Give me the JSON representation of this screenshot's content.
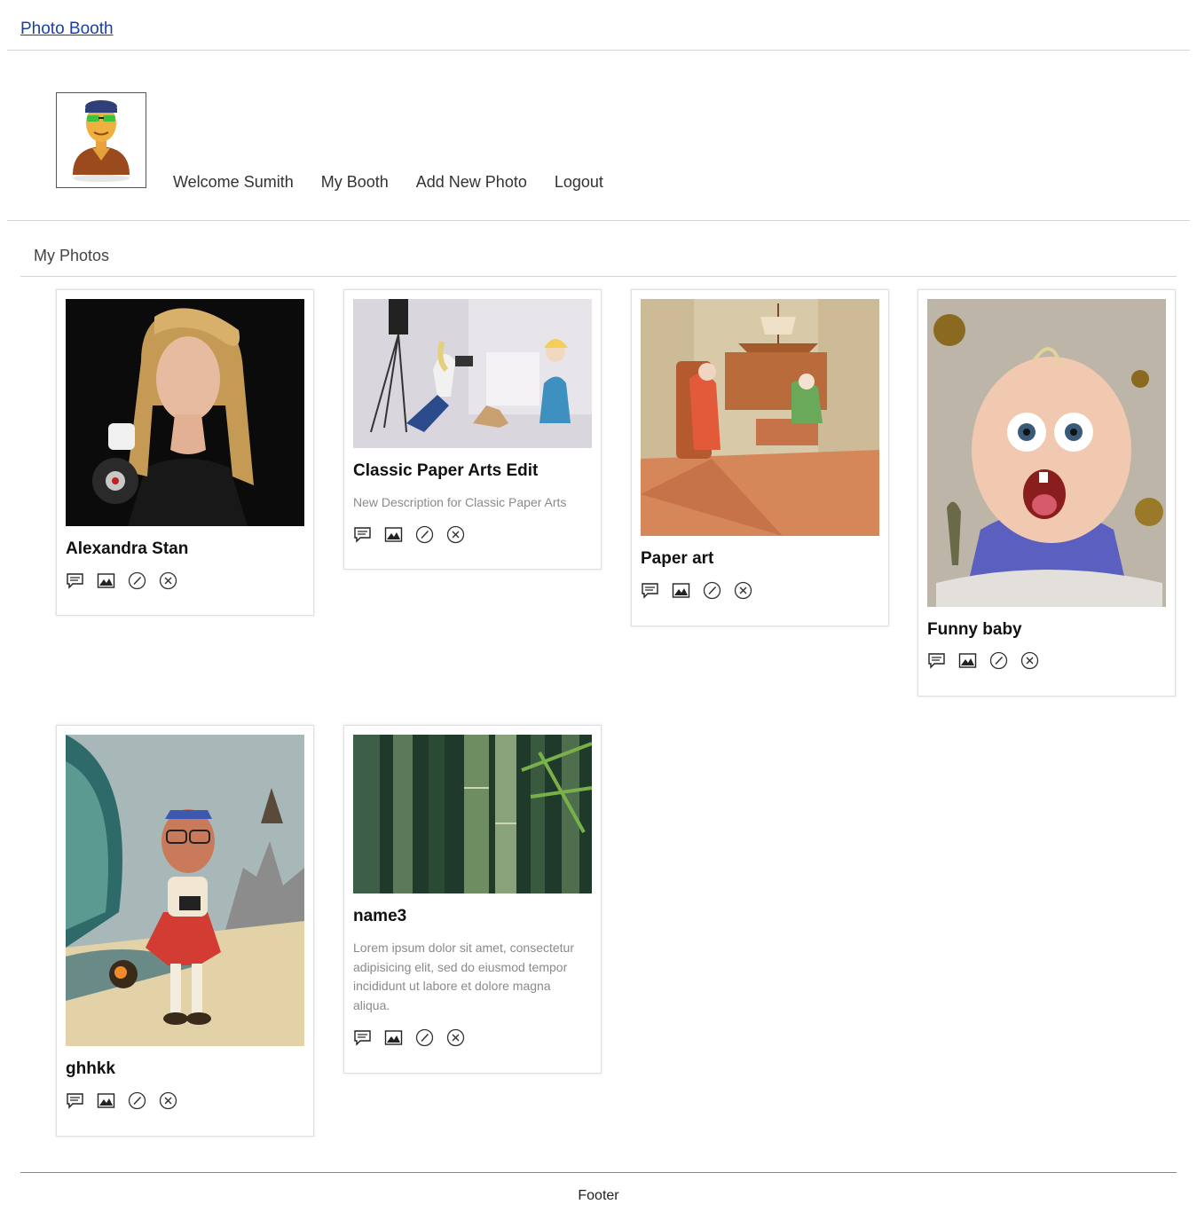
{
  "header": {
    "brand": "Photo Booth"
  },
  "nav": {
    "welcome": "Welcome Sumith",
    "items": [
      "My Booth",
      "Add New Photo",
      "Logout"
    ]
  },
  "section": {
    "title": "My Photos"
  },
  "photos": [
    {
      "title": "Alexandra Stan",
      "description": ""
    },
    {
      "title": "Classic Paper Arts Edit",
      "description": "New Description for Classic Paper Arts"
    },
    {
      "title": "Paper art",
      "description": ""
    },
    {
      "title": "Funny baby",
      "description": ""
    },
    {
      "title": "ghhkk",
      "description": ""
    },
    {
      "title": "name3",
      "description": "Lorem ipsum dolor sit amet, consectetur adipisicing elit, sed do eiusmod tempor incididunt ut labore et dolore magna aliqua."
    }
  ],
  "action_icons": [
    "comment-icon",
    "image-icon",
    "edit-icon",
    "delete-icon"
  ],
  "footer": {
    "text": "Footer"
  },
  "colors": {
    "link": "#1a3fa8",
    "description": "#8a8a8a",
    "divider": "#d4d4d4"
  }
}
